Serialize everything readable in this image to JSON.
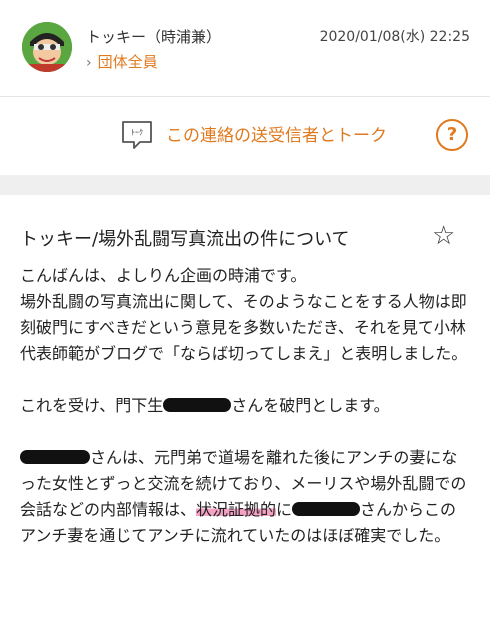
{
  "header": {
    "sender_name": "トッキー（時浦兼）",
    "recipient": "団体全員",
    "timestamp": "2020/01/08(水) 22:25"
  },
  "talk": {
    "icon_text": "ﾄｰｸ",
    "label": "この連絡の送受信者とトーク",
    "help_glyph": "?"
  },
  "message": {
    "title": "トッキー/場外乱闘写真流出の件について",
    "star_glyph": "☆",
    "p1": "こんばんは、よしりん企画の時浦です。",
    "p2": "場外乱闘の写真流出に関して、そのようなことをする人物は即刻破門にすべきだという意見を多数いただき、それを見て小林代表師範がブログで「ならば切ってしまえ」と表明しました。",
    "p3_before": "これを受け、門下生",
    "p3_after": "さんを破門とします。",
    "p4_a": "さんは、元門弟で道場を離れた後にアンチの妻になった女性とずっと交流を続けており、メーリスや場外乱闘での会話などの内部情報は、",
    "p4_hl": "状況証拠的",
    "p4_b": "に",
    "p4_c": "さんからこのアンチ妻を通じてアンチに流れていたのはほぼ確実でした。"
  }
}
